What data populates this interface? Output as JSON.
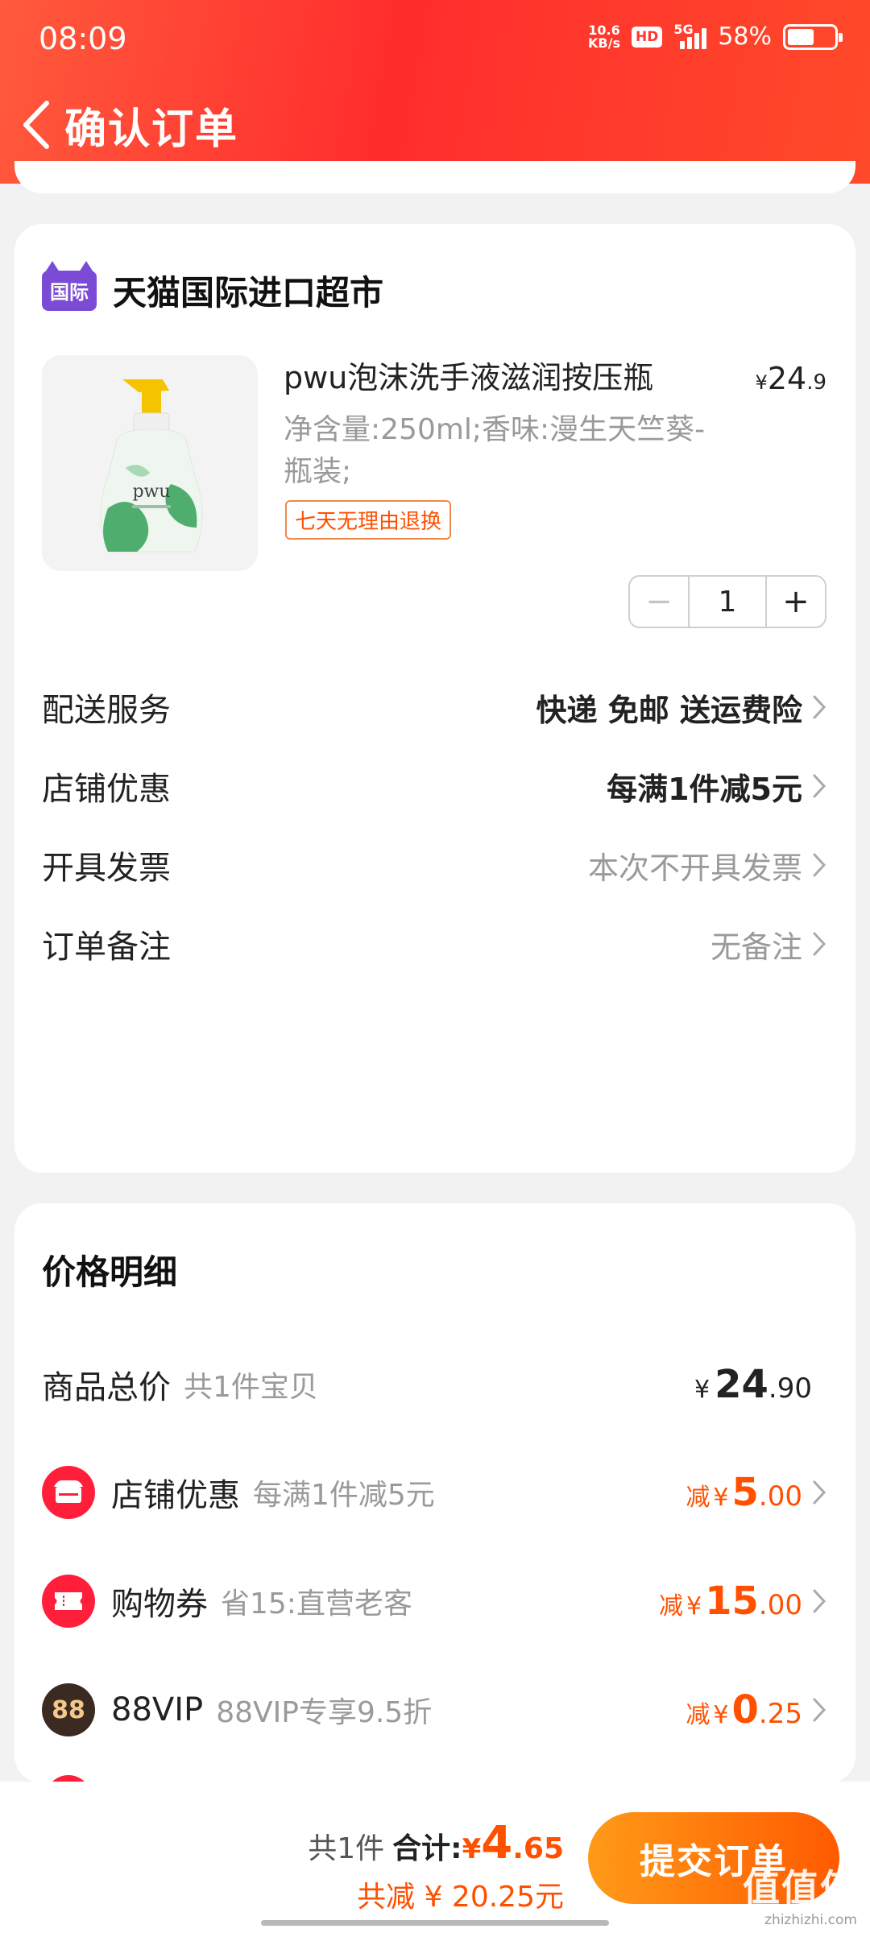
{
  "status_bar": {
    "time": "08:09",
    "net_speed_value": "10.6",
    "net_speed_unit": "KB/s",
    "hd": "HD",
    "network": "5G",
    "battery_percent": "58%",
    "battery_level": 0.58
  },
  "nav": {
    "title": "确认订单"
  },
  "order": {
    "shop_logo_text": "国际",
    "shop_name": "天猫国际进口超市",
    "product": {
      "title": "pwu泡沫洗手液滋润按压瓶",
      "price_yen": "¥",
      "price_int": "24",
      "price_dec": ".9",
      "spec": "净含量:250ml;香味:漫生天竺葵-瓶装;",
      "return_badge": "七天无理由退换",
      "quantity": "1",
      "minus": "−",
      "plus": "+",
      "image_text": "pwu"
    },
    "options": [
      {
        "label": "配送服务",
        "value": "快递 免邮 送运费险"
      },
      {
        "label": "店铺优惠",
        "value": "每满1件减5元"
      },
      {
        "label": "开具发票",
        "value": "本次不开具发票"
      },
      {
        "label": "订单备注",
        "value": "无备注"
      }
    ]
  },
  "price_detail": {
    "title": "价格明细",
    "total": {
      "label": "商品总价",
      "sub": "共1件宝贝",
      "yen": "¥",
      "int": "24",
      "dec": ".90"
    },
    "discounts": [
      {
        "label": "店铺优惠",
        "sub": "每满1件减5元",
        "pre": "减",
        "yen": "¥",
        "int": "5",
        "dec": ".00",
        "icon": "shop-discount-icon"
      },
      {
        "label": "购物券",
        "sub": "省15:直营老客",
        "pre": "减",
        "yen": "¥",
        "int": "15",
        "dec": ".00",
        "icon": "coupon-icon"
      },
      {
        "label": "88VIP",
        "sub": "88VIP专享9.5折",
        "pre": "减",
        "yen": "¥",
        "int": "0",
        "dec": ".25",
        "icon": "vip-88-icon",
        "icon_text": "88"
      }
    ]
  },
  "bottom_bar": {
    "count": "共1件",
    "sum_label": "合计:",
    "sum_yen": "¥",
    "sum_int": "4",
    "sum_dec": ".65",
    "saved": "共减 ¥ 20.25元",
    "submit": "提交订单",
    "watermark": "值值值",
    "watermark_url": "zhizhizhi.com"
  },
  "colors": {
    "header_red": "#ff2d2d",
    "accent_orange": "#ff5000",
    "submit_gradient_start": "#ff9a18",
    "submit_gradient_end": "#ff5a00",
    "tmall_purple": "#7b4bd6"
  }
}
